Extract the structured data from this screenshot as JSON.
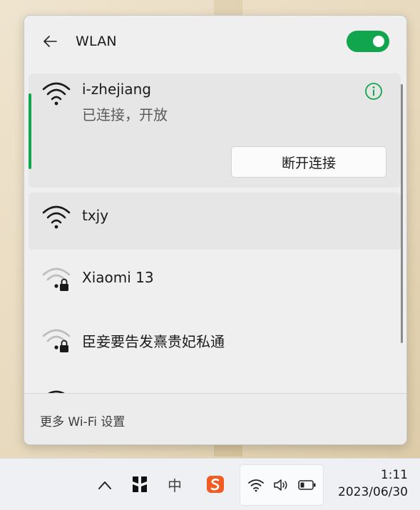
{
  "flyout": {
    "title": "WLAN",
    "wifi_enabled": true,
    "footer_link": "更多 Wi-Fi 设置"
  },
  "networks": [
    {
      "name": "i-zhejiang",
      "status": "已连接，开放",
      "secured": false,
      "signal": "strong",
      "connected": true,
      "action": "断开连接"
    },
    {
      "name": "txjy",
      "secured": false,
      "signal": "strong"
    },
    {
      "name": "Xiaomi 13",
      "secured": true,
      "signal": "weak"
    },
    {
      "name": "臣妾要告发熹贵妃私通",
      "secured": true,
      "signal": "weak"
    }
  ],
  "taskbar": {
    "ime_label": "中",
    "time": "1:11",
    "date": "2023/06/30"
  },
  "colors": {
    "accent": "#11a64d",
    "flyout_bg": "#efefef",
    "selected_bg": "#e6e6e6"
  },
  "icons": [
    "back-arrow-icon",
    "wifi-strong-icon",
    "wifi-weak-lock-icon",
    "info-icon",
    "chevron-up-icon",
    "pinyin-ime-icon",
    "sogou-icon",
    "wifi-tray-icon",
    "volume-icon",
    "battery-icon"
  ]
}
